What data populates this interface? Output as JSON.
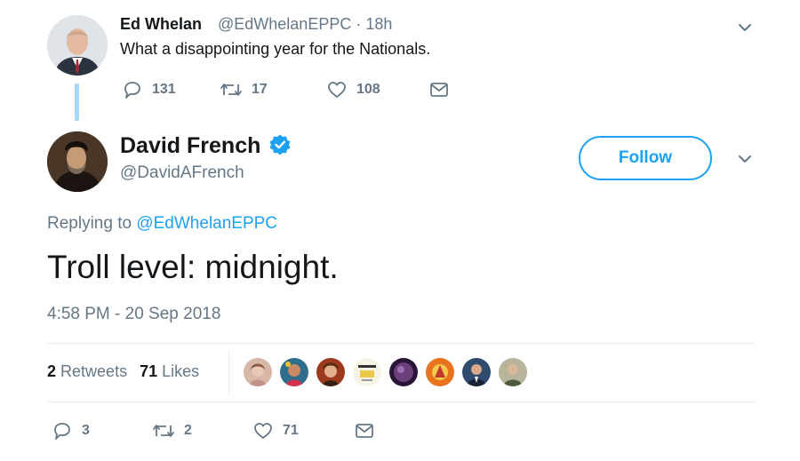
{
  "parent_tweet": {
    "author_name": "Ed Whelan",
    "author_handle": "@EdWhelanEPPC · 18h",
    "text": "What a disappointing year for the Nationals.",
    "replies": "131",
    "retweets": "17",
    "likes": "108"
  },
  "main_tweet": {
    "author_name": "David French",
    "author_handle": "@DavidAFrench",
    "follow_label": "Follow",
    "replying_prefix": "Replying to ",
    "replying_to": "@EdWhelanEPPC",
    "text": "Troll level: midnight.",
    "timestamp": "4:58 PM - 20 Sep 2018",
    "retweets_count": "2",
    "retweets_label": "Retweets",
    "likes_count": "71",
    "likes_label": "Likes",
    "replies": "3",
    "retweet_action_count": "2",
    "like_action_count": "71"
  },
  "icons": {
    "reply": "reply-icon",
    "retweet": "retweet-icon",
    "like": "heart-icon",
    "dm": "envelope-icon",
    "more": "chevron-down-icon",
    "verified": "verified-badge-icon"
  },
  "colors": {
    "accent": "#1da1f2",
    "muted": "#657786",
    "text": "#14171a",
    "thread_line": "#a8d6f5"
  }
}
